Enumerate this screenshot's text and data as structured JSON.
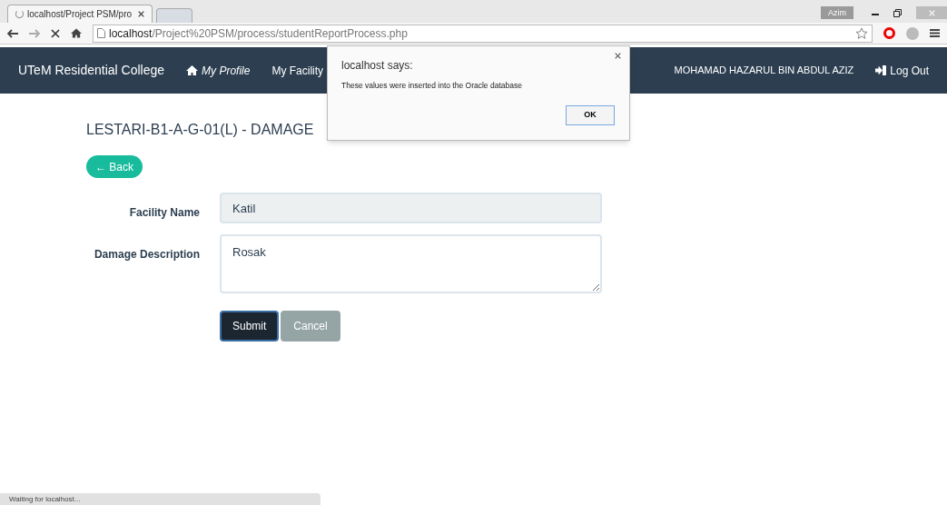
{
  "browser": {
    "tab_title": "localhost/Project PSM/pro",
    "profile": "Azim",
    "url_host": "localhost",
    "url_path": "/Project%20PSM/process/studentReportProcess.php"
  },
  "navbar": {
    "brand": "UTeM Residential College",
    "links": [
      {
        "label": "My Profile",
        "kind": "home",
        "italic": true
      },
      {
        "label": "My Facility",
        "kind": "plain",
        "italic": false
      }
    ],
    "user": "MOHAMAD HAZARUL BIN ABDUL AZIZ",
    "logout": "Log Out"
  },
  "page": {
    "heading": "LESTARI-B1-A-G-01(L) - DAMAGE",
    "back": "← Back",
    "fields": [
      {
        "label": "Facility Name",
        "value": "Katil",
        "kind": "input",
        "disabled": true
      },
      {
        "label": "Damage Description",
        "value": "Rosak",
        "kind": "textarea",
        "disabled": false
      }
    ],
    "buttons": [
      {
        "label": "Submit",
        "kind": "primary"
      },
      {
        "label": "Cancel",
        "kind": "secondary"
      }
    ]
  },
  "dialog": {
    "title": "localhost says:",
    "message": "These values were inserted into the Oracle database",
    "button": "OK"
  },
  "status_bar": "Waiting for localhost..."
}
